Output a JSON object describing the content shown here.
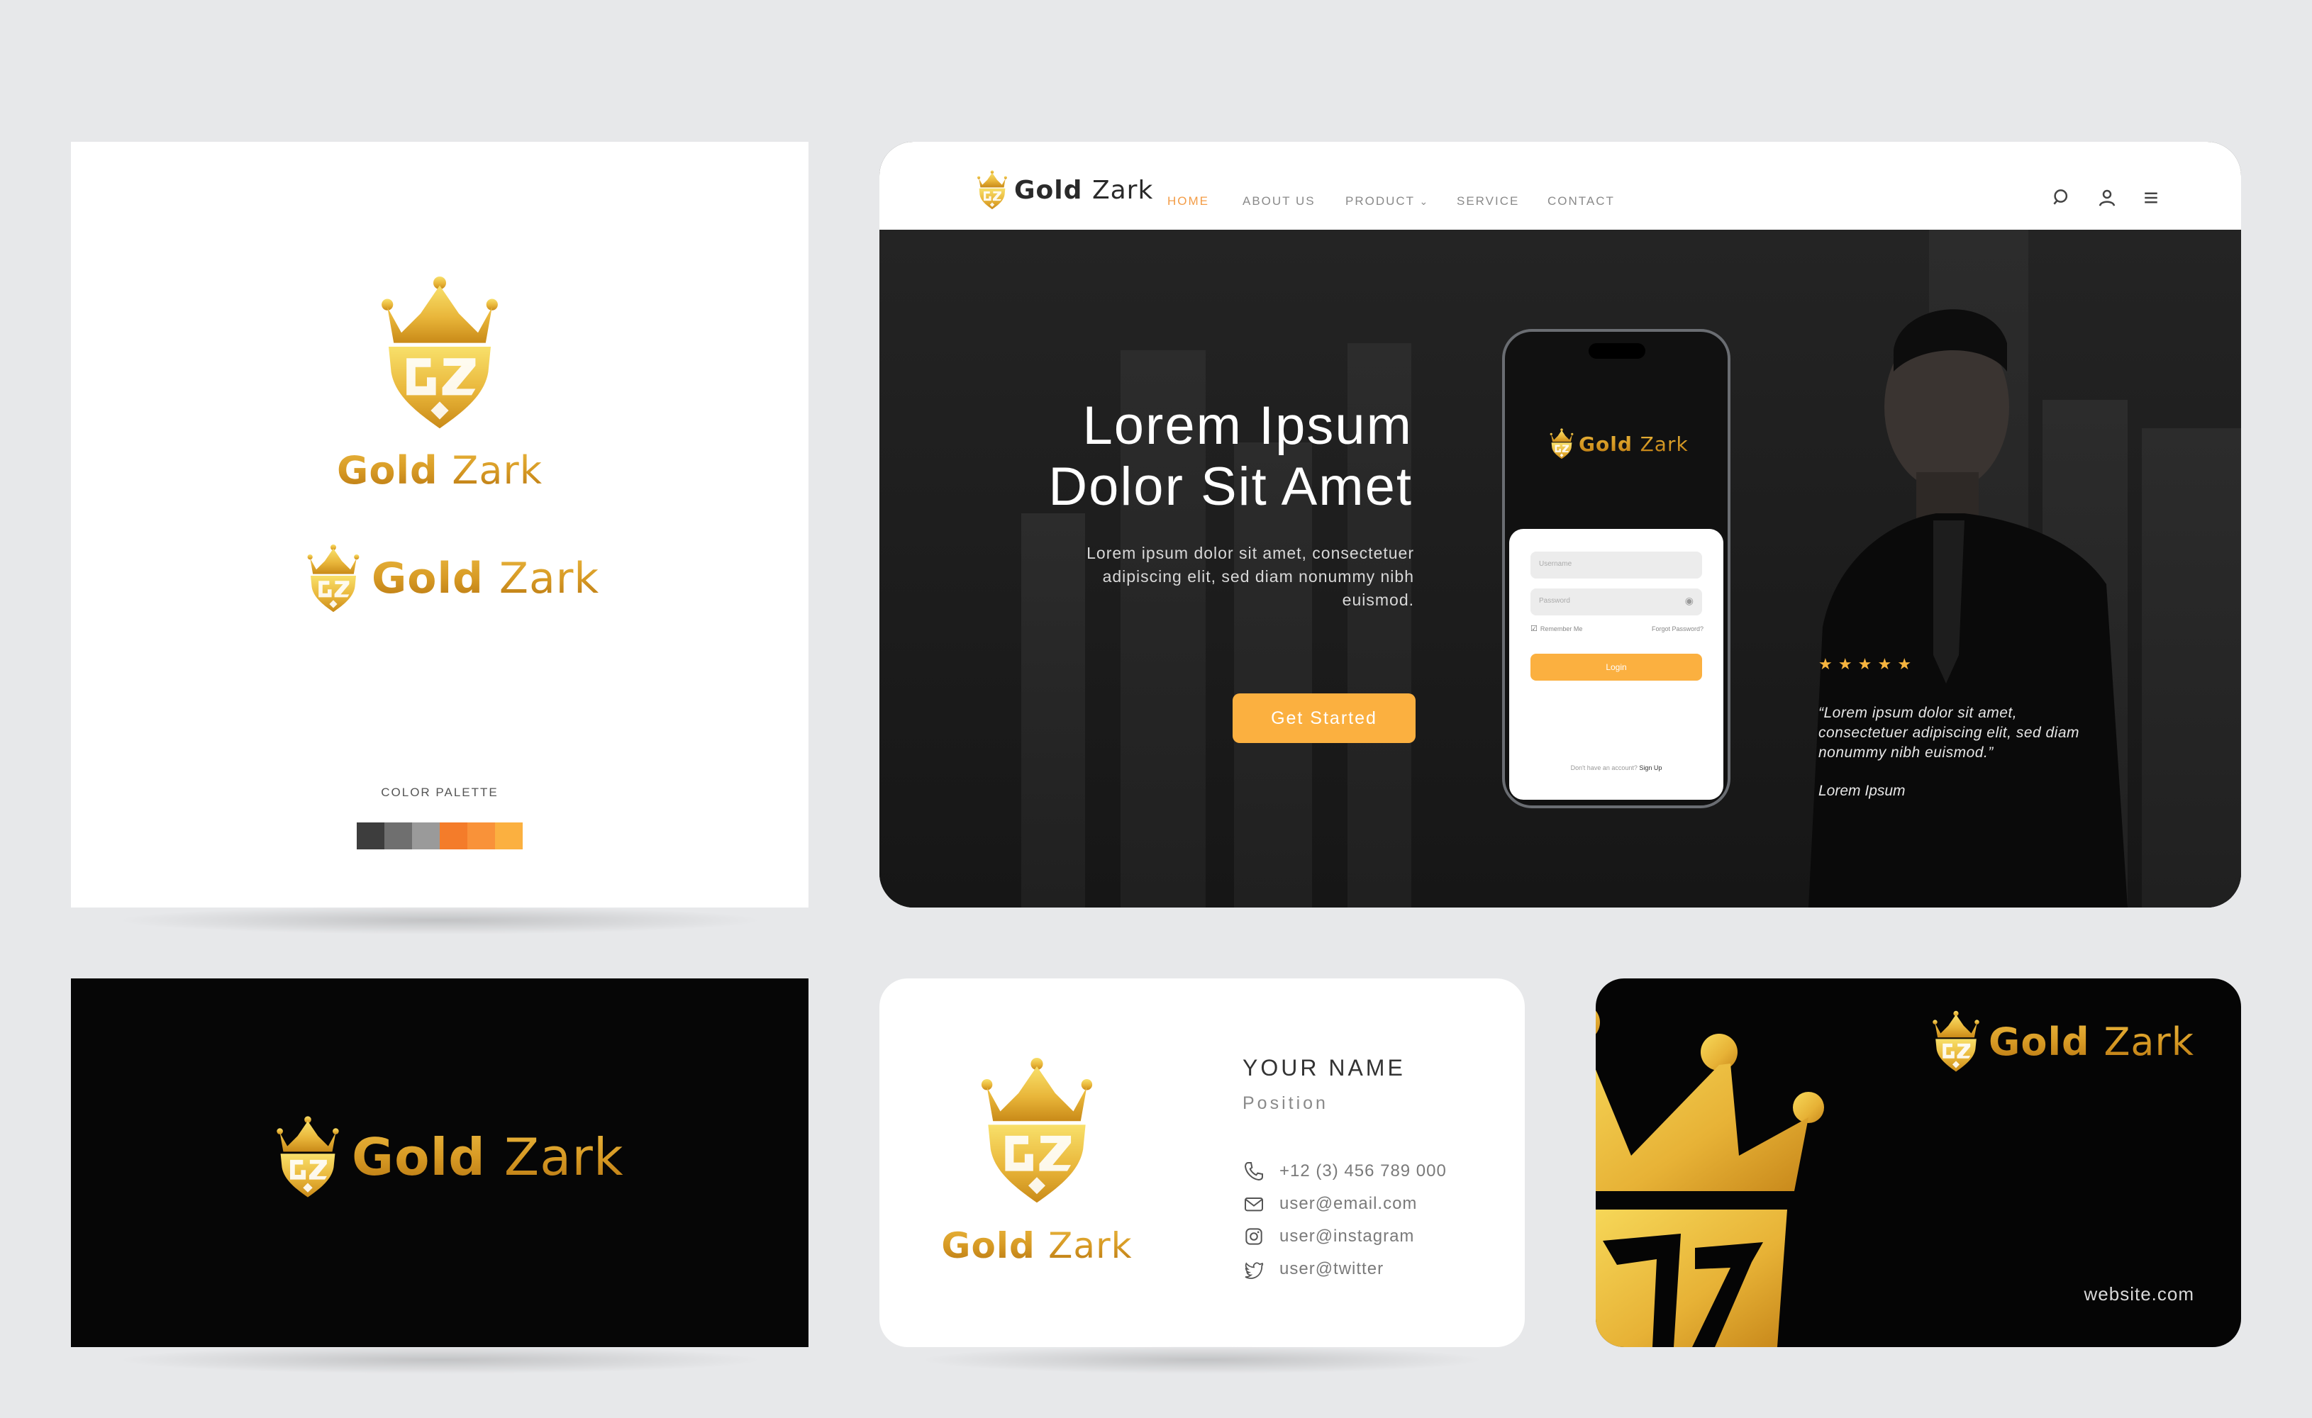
{
  "brand": {
    "name_primary": "Gold",
    "name_secondary": "Zark",
    "monogram": "GZ"
  },
  "colors": {
    "gold_light": "#f6d95c",
    "gold_mid": "#e8b43c",
    "gold_dark": "#b77712",
    "accent_orange": "#fbb040",
    "nav_active": "#f39c46"
  },
  "logo_sheet": {
    "palette_label": "COLOR PALETTE",
    "palette": [
      "#3d3d3d",
      "#6f6f6f",
      "#9a9a9a",
      "#f47c2a",
      "#f99239",
      "#fbb040"
    ]
  },
  "website": {
    "nav": {
      "items": [
        {
          "label": "HOME",
          "active": true
        },
        {
          "label": "ABOUT US",
          "active": false
        },
        {
          "label": "PRODUCT",
          "active": false,
          "has_dropdown": true
        },
        {
          "label": "SERVICE",
          "active": false
        },
        {
          "label": "CONTACT",
          "active": false
        }
      ],
      "icons": [
        "search-icon",
        "user-icon",
        "menu-icon"
      ]
    },
    "hero": {
      "title_line1": "Lorem Ipsum",
      "title_line2": "Dolor Sit Amet",
      "subtitle_line1": "Lorem ipsum dolor sit amet, consectetuer",
      "subtitle_line2": "adipiscing elit, sed diam nonummy nibh",
      "subtitle_line3": "euismod.",
      "cta_label": "Get Started"
    },
    "phone": {
      "username_placeholder": "Username",
      "password_placeholder": "Password",
      "remember_label": "Remember Me",
      "forgot_label": "Forgot Password?",
      "login_label": "Login",
      "signup_prompt": "Don't have an account?",
      "signup_link": "Sign Up"
    },
    "testimonial": {
      "rating": 5,
      "stars": "★ ★ ★ ★ ★",
      "quote_line1": "“Lorem ipsum dolor sit amet,",
      "quote_line2": "consectetuer adipiscing elit, sed diam",
      "quote_line3": "nonummy nibh euismod.”",
      "author": "Lorem Ipsum"
    }
  },
  "business_card": {
    "name": "YOUR NAME",
    "position": "Position",
    "phone": "+12 (3) 456 789 000",
    "email": "user@email.com",
    "instagram": "user@instagram",
    "twitter": "user@twitter",
    "website": "website.com"
  }
}
